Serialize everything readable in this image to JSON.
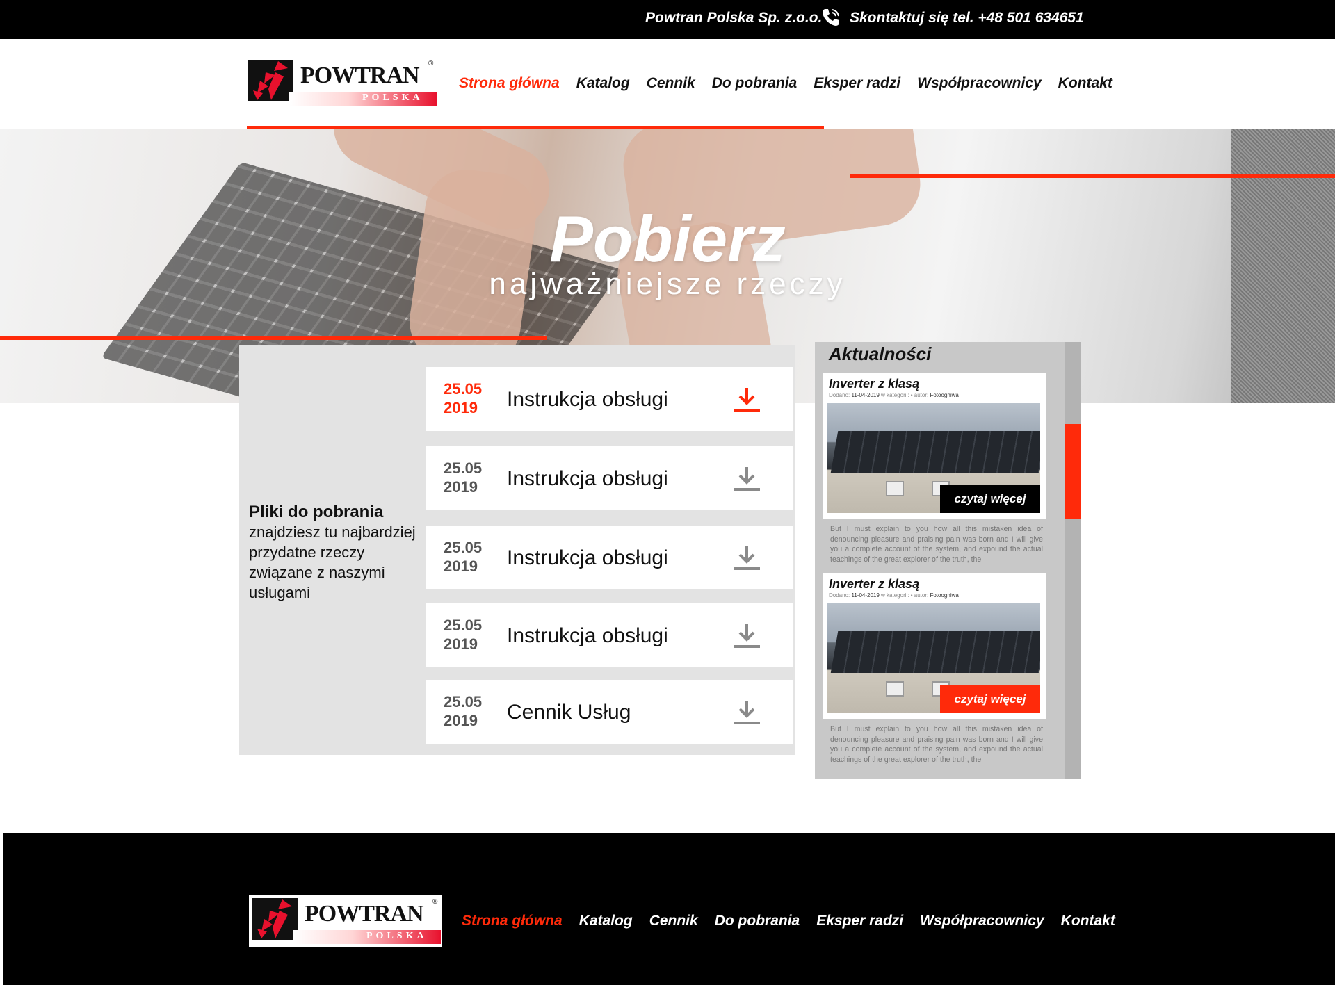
{
  "topbar": {
    "company": "Powtran Polska Sp. z.o.o.",
    "phone_icon": "phone-icon",
    "phone": "Skontaktuj się tel. +48 501 634651"
  },
  "logo": {
    "brand": "POWTRAN",
    "registered": "®",
    "sub": "POLSKA"
  },
  "nav": {
    "items": [
      "Strona główna",
      "Katalog",
      "Cennik",
      "Do pobrania",
      "Eksper radzi",
      "Współpracownicy",
      "Kontakt"
    ],
    "active": "Strona główna"
  },
  "hero": {
    "title": "Pobierz",
    "subtitle": "najważniejsze rzeczy"
  },
  "downloads": {
    "intro_lead": "Pliki do pobrania",
    "intro_text": "znajdziesz tu najbardziej przydatne rzeczy związane z naszymi usługami",
    "items": [
      {
        "date_day": "25.05",
        "date_year": "2019",
        "title": "Instrukcja obsługi",
        "icon": "download-icon",
        "highlighted": true
      },
      {
        "date_day": "25.05",
        "date_year": "2019",
        "title": "Instrukcja obsługi",
        "icon": "download-icon",
        "highlighted": false
      },
      {
        "date_day": "25.05",
        "date_year": "2019",
        "title": "Instrukcja obsługi",
        "icon": "download-icon",
        "highlighted": false
      },
      {
        "date_day": "25.05",
        "date_year": "2019",
        "title": "Instrukcja obsługi",
        "icon": "download-icon",
        "highlighted": false
      },
      {
        "date_day": "25.05",
        "date_year": "2019",
        "title": "Cennik Usług",
        "icon": "download-icon",
        "highlighted": false
      }
    ]
  },
  "news": {
    "title": "Aktualności",
    "posts": [
      {
        "title": "Inverter z klasą",
        "meta_added": "Dodano:",
        "meta_date": "11-04-2019",
        "meta_category": "w kategorii:",
        "meta_author": "• autor:",
        "meta_author_name": "Fotoogniwa",
        "more": "czytaj więcej",
        "more_color": "#000000",
        "excerpt": "But I must explain to you how all this mistaken idea of denouncing pleasure and praising pain was born and I will give you a complete account of the system, and expound the actual teachings of the great explorer of the truth, the"
      },
      {
        "title": "Inverter z klasą",
        "meta_added": "Dodano:",
        "meta_date": "11-04-2019",
        "meta_category": "w kategorii:",
        "meta_author": "• autor:",
        "meta_author_name": "Fotoogniwa",
        "more": "czytaj więcej",
        "more_color": "#ff2a0a",
        "excerpt": "But I must explain to you how all this mistaken idea of denouncing pleasure and praising pain was born and I will give you a complete account of the system, and expound the actual teachings of the great explorer of the truth, the"
      }
    ]
  },
  "colors": {
    "accent": "#ff2a0a",
    "topbar": "#000000",
    "panel": "#e3e3e3",
    "news_panel": "#c8c8c8"
  }
}
